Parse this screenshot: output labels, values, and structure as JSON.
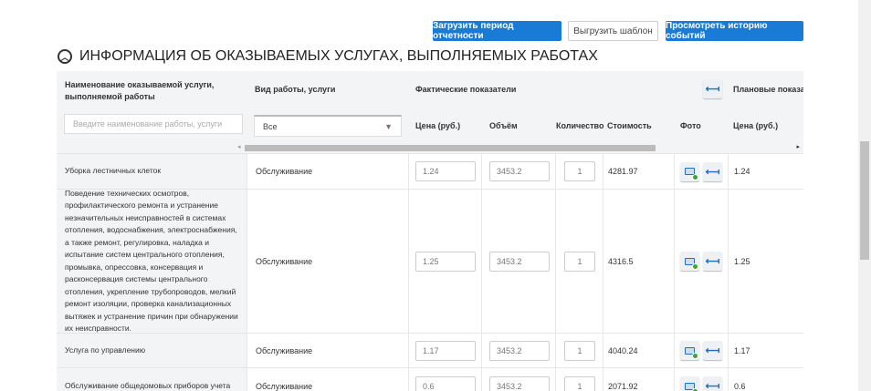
{
  "toolbar": {
    "upload": "Загрузить период отчетности",
    "download": "Выгрузить шаблон",
    "history": "Просмотреть историю событий"
  },
  "section_title": "ИНФОРМАЦИЯ ОБ ОКАЗЫВАЕМЫХ УСЛУГАХ, ВЫПОЛНЯЕМЫХ РАБОТАХ",
  "headers": {
    "name": "Наименование оказываемой услуги, выполняемой работы",
    "type": "Вид работы, услуги",
    "actual": "Фактические показатели",
    "planned": "Плановые показат",
    "price": "Цена (руб.)",
    "volume": "Объём",
    "qty": "Количество",
    "cost": "Стоимость",
    "photo": "Фото",
    "plan_price": "Цена (руб.)"
  },
  "filters": {
    "name_placeholder": "Введите наименование работы, услуги",
    "type_value": "Все"
  },
  "rows": [
    {
      "name": "Уборка лестничных клеток",
      "type": "Обслуживание",
      "price": "1.24",
      "volume": "3453.2",
      "qty": "1",
      "cost": "4281.97",
      "plan_price": "1.24"
    },
    {
      "name": "Поведение технических осмотров, профилактического ремонта и устранение незначительных неисправностей в системах отопления, водоснабжения, электроснабжения, а также ремонт, регулировка, наладка и испытание систем центрального отопления, промывка, опрессовка, консервация и расконсервация системы центрального отопления, укрепление трубопроводов, мелкий ремонт изоляции, проверка канализационных вытяжек и устранение причин при обнаружении их неисправности.",
      "type": "Обслуживание",
      "price": "1.25",
      "volume": "3453.2",
      "qty": "1",
      "cost": "4316.5",
      "plan_price": "1.25"
    },
    {
      "name": "Услуга по управлению",
      "type": "Обслуживание",
      "price": "1.17",
      "volume": "3453.2",
      "qty": "1",
      "cost": "4040.24",
      "plan_price": "1.17"
    },
    {
      "name": "Обслуживание общедомовых приборов учета",
      "type": "Обслуживание",
      "price": "0.6",
      "volume": "3453.2",
      "qty": "1",
      "cost": "2071.92",
      "plan_price": "0.6"
    }
  ]
}
